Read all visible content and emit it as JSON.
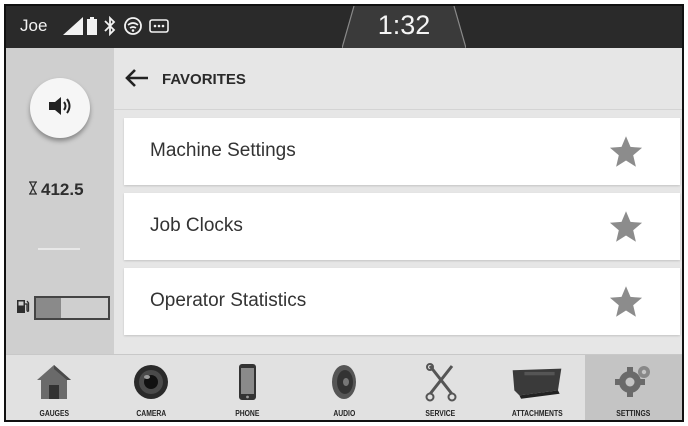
{
  "status": {
    "user": "Joe",
    "time": "1:32",
    "icons": [
      "signal-icon",
      "battery-icon",
      "bluetooth-icon",
      "wifi-icon",
      "message-icon"
    ]
  },
  "left": {
    "volume_icon": "volume-icon",
    "hours_icon": "hourglass-icon",
    "hours": "412.5",
    "fuel_icon": "fuel-pump-icon",
    "fuel_level": 0.35
  },
  "header": {
    "back_icon": "back-arrow-icon",
    "title": "FAVORITES"
  },
  "favorites": [
    {
      "label": "Machine Settings",
      "icon": "star-icon"
    },
    {
      "label": "Job Clocks",
      "icon": "star-icon"
    },
    {
      "label": "Operator Statistics",
      "icon": "star-icon"
    }
  ],
  "nav": [
    {
      "label": "GAUGES",
      "icon": "house-icon"
    },
    {
      "label": "CAMERA",
      "icon": "camera-icon"
    },
    {
      "label": "PHONE",
      "icon": "phone-icon"
    },
    {
      "label": "AUDIO",
      "icon": "speaker-icon"
    },
    {
      "label": "SERVICE",
      "icon": "wrench-icon"
    },
    {
      "label": "ATTACHMENTS",
      "icon": "bucket-icon"
    },
    {
      "label": "SETTINGS",
      "icon": "gear-icon",
      "active": true
    }
  ],
  "colors": {
    "statusbar": "#2a2a2a",
    "panel": "#cfcfcf",
    "background": "#e6e6e6",
    "active_tab": "#c4c4c4",
    "star": "#8c8c8c"
  }
}
